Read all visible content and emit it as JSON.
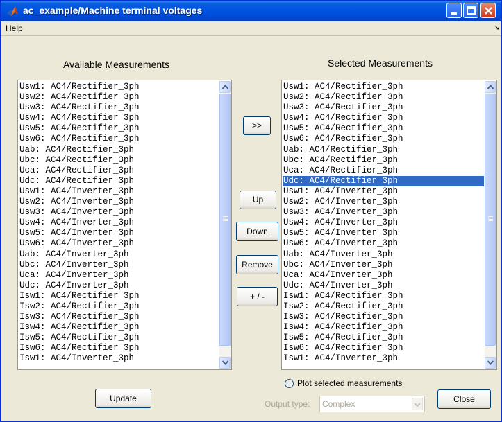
{
  "window": {
    "title": "ac_example/Machine terminal voltages"
  },
  "menu": {
    "help": "Help"
  },
  "available": {
    "label": "Available Measurements",
    "items": [
      "Usw1: AC4/Rectifier_3ph",
      "Usw2: AC4/Rectifier_3ph",
      "Usw3: AC4/Rectifier_3ph",
      "Usw4: AC4/Rectifier_3ph",
      "Usw5: AC4/Rectifier_3ph",
      "Usw6: AC4/Rectifier_3ph",
      "Uab: AC4/Rectifier_3ph",
      "Ubc: AC4/Rectifier_3ph",
      "Uca: AC4/Rectifier_3ph",
      "Udc: AC4/Rectifier_3ph",
      "Usw1: AC4/Inverter_3ph",
      "Usw2: AC4/Inverter_3ph",
      "Usw3: AC4/Inverter_3ph",
      "Usw4: AC4/Inverter_3ph",
      "Usw5: AC4/Inverter_3ph",
      "Usw6: AC4/Inverter_3ph",
      "Uab: AC4/Inverter_3ph",
      "Ubc: AC4/Inverter_3ph",
      "Uca: AC4/Inverter_3ph",
      "Udc: AC4/Inverter_3ph",
      "Isw1: AC4/Rectifier_3ph",
      "Isw2: AC4/Rectifier_3ph",
      "Isw3: AC4/Rectifier_3ph",
      "Isw4: AC4/Rectifier_3ph",
      "Isw5: AC4/Rectifier_3ph",
      "Isw6: AC4/Rectifier_3ph",
      "Isw1: AC4/Inverter_3ph"
    ]
  },
  "selected": {
    "label": "Selected Measurements",
    "highlighted_index": 9,
    "items": [
      "Usw1: AC4/Rectifier_3ph",
      "Usw2: AC4/Rectifier_3ph",
      "Usw3: AC4/Rectifier_3ph",
      "Usw4: AC4/Rectifier_3ph",
      "Usw5: AC4/Rectifier_3ph",
      "Usw6: AC4/Rectifier_3ph",
      "Uab: AC4/Rectifier_3ph",
      "Ubc: AC4/Rectifier_3ph",
      "Uca: AC4/Rectifier_3ph",
      "Udc: AC4/Rectifier_3ph",
      "Usw1: AC4/Inverter_3ph",
      "Usw2: AC4/Inverter_3ph",
      "Usw3: AC4/Inverter_3ph",
      "Usw4: AC4/Inverter_3ph",
      "Usw5: AC4/Inverter_3ph",
      "Usw6: AC4/Inverter_3ph",
      "Uab: AC4/Inverter_3ph",
      "Ubc: AC4/Inverter_3ph",
      "Uca: AC4/Inverter_3ph",
      "Udc: AC4/Inverter_3ph",
      "Isw1: AC4/Rectifier_3ph",
      "Isw2: AC4/Rectifier_3ph",
      "Isw3: AC4/Rectifier_3ph",
      "Isw4: AC4/Rectifier_3ph",
      "Isw5: AC4/Rectifier_3ph",
      "Isw6: AC4/Rectifier_3ph",
      "Isw1: AC4/Inverter_3ph"
    ]
  },
  "buttons": {
    "add": ">>",
    "up": "Up",
    "down": "Down",
    "remove": "Remove",
    "sign": "+ / -",
    "update": "Update",
    "close": "Close"
  },
  "plot": {
    "label": "Plot selected measurements",
    "checked": false
  },
  "output": {
    "label": "Output type:",
    "value": "Complex"
  },
  "colors": {
    "titlebar": "#0054e3",
    "selection": "#316ac5",
    "window_bg": "#ece9d8"
  },
  "icons": [
    "matlab-icon",
    "minimize-icon",
    "maximize-icon",
    "close-icon",
    "scroll-up-icon",
    "scroll-down-icon",
    "dropdown-arrow-icon"
  ]
}
